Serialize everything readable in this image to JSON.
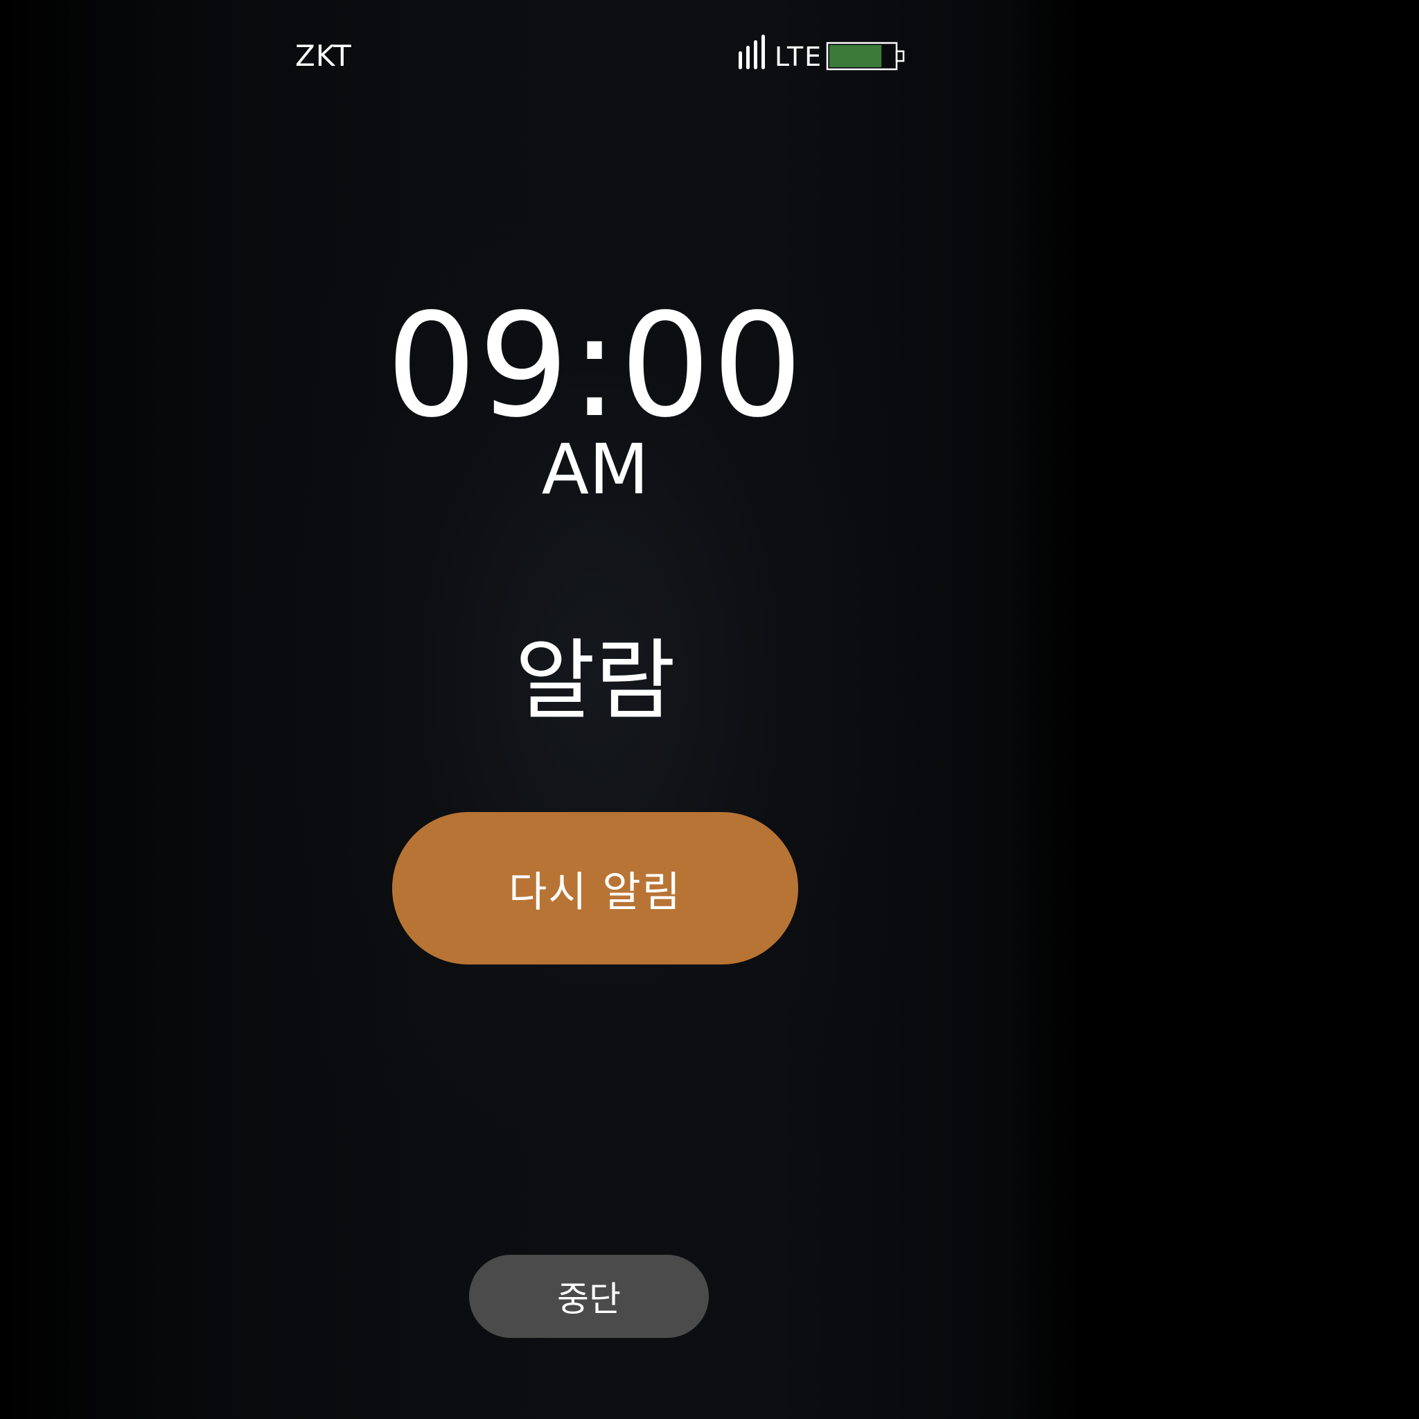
{
  "status_bar": {
    "carrier": "ZKT",
    "network": "LTE",
    "signal_icon": "signal-bars-icon",
    "battery_icon": "battery-icon",
    "battery_level": 0.8,
    "battery_color": "#3c7a3a"
  },
  "alarm": {
    "time": "09:00",
    "period": "AM",
    "label": "알람"
  },
  "actions": {
    "snooze_label": "다시 알림",
    "snooze_color": "#b87435",
    "stop_label": "중단",
    "stop_color": "#4b4b4b"
  }
}
